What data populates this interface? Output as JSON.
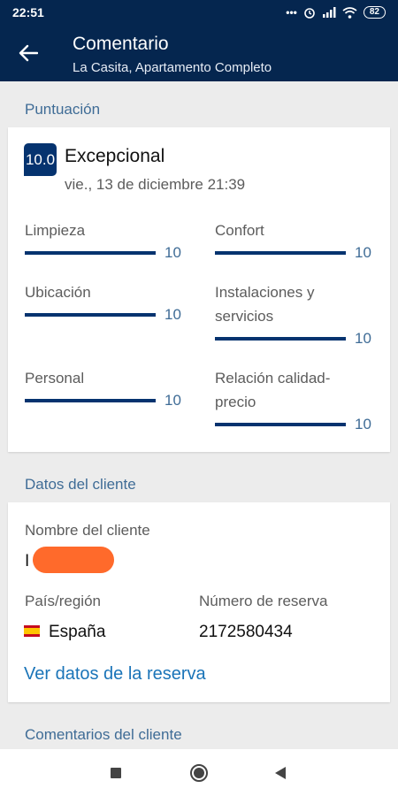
{
  "status_bar": {
    "time": "22:51",
    "battery": "82"
  },
  "app_bar": {
    "title": "Comentario",
    "subtitle": "La Casita, Apartamento Completo"
  },
  "rating": {
    "section_title": "Puntuación",
    "score": "10.0",
    "score_word": "Excepcional",
    "date": "vie., 13 de diciembre 21:39",
    "categories": [
      {
        "label": "Limpieza",
        "value": "10",
        "fraction": 1.0
      },
      {
        "label": "Confort",
        "value": "10",
        "fraction": 1.0
      },
      {
        "label": "Ubicación",
        "value": "10",
        "fraction": 1.0
      },
      {
        "label": "Instalaciones y servicios",
        "value": "10",
        "fraction": 1.0
      },
      {
        "label": "Personal",
        "value": "10",
        "fraction": 1.0
      },
      {
        "label": "Relación calidad-precio",
        "value": "10",
        "fraction": 1.0
      }
    ]
  },
  "guest": {
    "section_title": "Datos del cliente",
    "name_label": "Nombre del cliente",
    "name_value": "I",
    "country_label": "País/región",
    "country_value": "España",
    "booking_label": "Número de reserva",
    "booking_value": "2172580434",
    "link": "Ver datos de la reserva"
  },
  "comments": {
    "section_title": "Comentarios del cliente"
  }
}
